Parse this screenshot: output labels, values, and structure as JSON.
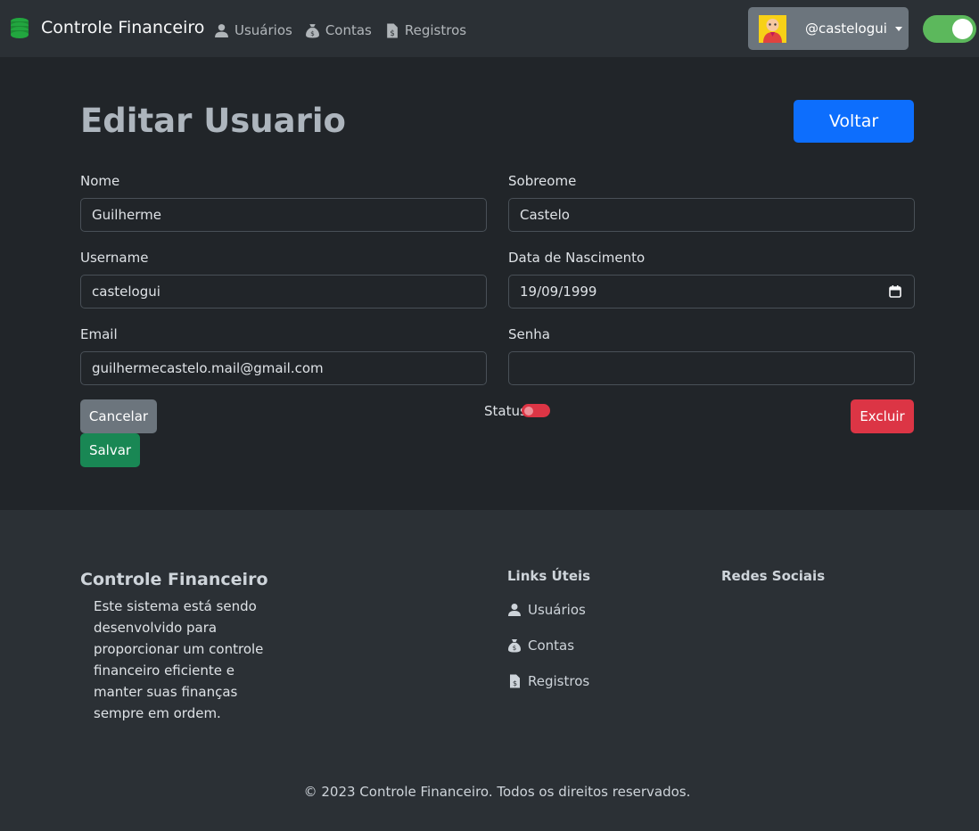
{
  "navbar": {
    "brand": "Controle Financeiro",
    "links": [
      {
        "label": "Usuários",
        "icon": "user-icon"
      },
      {
        "label": "Contas",
        "icon": "money-bag-icon"
      },
      {
        "label": "Registros",
        "icon": "invoice-icon"
      }
    ],
    "username": "@castelogui",
    "theme_toggle_on": true
  },
  "form": {
    "title": "Editar Usuario",
    "back_label": "Voltar",
    "fields": {
      "nome": {
        "label": "Nome",
        "value": "Guilherme"
      },
      "sobrenome": {
        "label": "Sobreome",
        "value": "Castelo"
      },
      "username": {
        "label": "Username",
        "value": "castelogui"
      },
      "nascimento": {
        "label": "Data de Nascimento",
        "value": "19/09/1999"
      },
      "email": {
        "label": "Email",
        "value": "guilhermecastelo.mail@gmail.com"
      },
      "senha": {
        "label": "Senha",
        "value": ""
      }
    },
    "cancel_label": "Cancelar",
    "save_label": "Salvar",
    "status_label": "Status",
    "status_on": false,
    "delete_label": "Excluir"
  },
  "footer": {
    "brand": "Controle Financeiro",
    "description": "Este sistema está sendo desenvolvido para proporcionar um controle financeiro eficiente e manter suas finanças sempre em ordem.",
    "links_heading": "Links Úteis",
    "links": [
      {
        "label": "Usuários",
        "icon": "user-icon"
      },
      {
        "label": "Contas",
        "icon": "money-bag-icon"
      },
      {
        "label": "Registros",
        "icon": "invoice-icon"
      }
    ],
    "social_heading": "Redes Sociais",
    "copyright": "© 2023 Controle Financeiro. Todos os direitos reservados."
  },
  "colors": {
    "primary": "#0d6efd",
    "secondary": "#6c757d",
    "success": "#198754",
    "danger": "#dc3545",
    "brand_icon": "#1f9d3a",
    "toggle_on": "#5cb85c"
  }
}
